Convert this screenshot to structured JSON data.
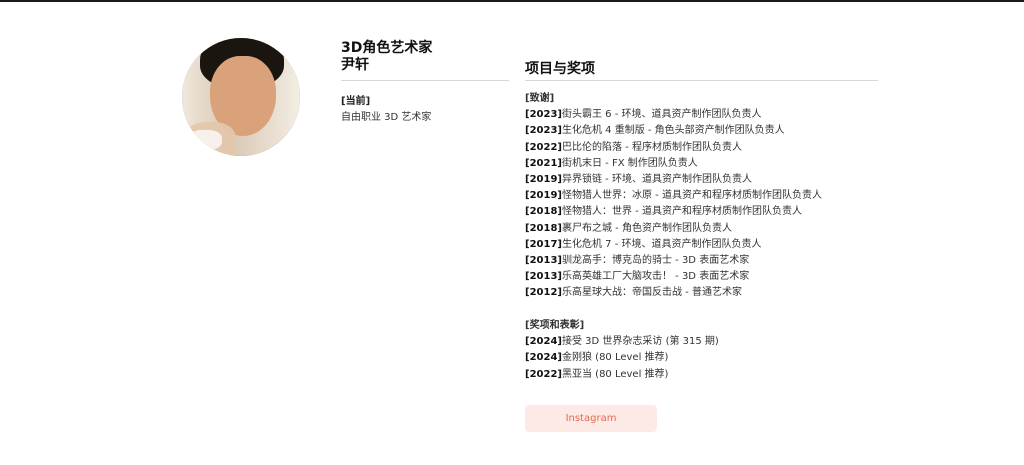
{
  "profile": {
    "title_line1": "3D角色艺术家",
    "title_line2": "尹轩",
    "current_label": "[当前]",
    "current_value": "自由职业 3D 艺术家"
  },
  "projects": {
    "heading": "项目与奖项",
    "credits_label": "[致谢]",
    "credits": [
      {
        "year": "[2023]",
        "text": "街头霸王 6 - 环境、道具资产制作团队负责人"
      },
      {
        "year": "[2023]",
        "text": "生化危机 4 重制版 - 角色头部资产制作团队负责人"
      },
      {
        "year": "[2022]",
        "text": "巴比伦的陷落 - 程序材质制作团队负责人"
      },
      {
        "year": "[2021]",
        "text": "街机末日 - FX 制作团队负责人"
      },
      {
        "year": "[2019]",
        "text": "异界锁链 - 环境、道具资产制作团队负责人"
      },
      {
        "year": "[2019]",
        "text": "怪物猎人世界：冰原 - 道具资产和程序材质制作团队负责人"
      },
      {
        "year": "[2018]",
        "text": "怪物猎人：世界 - 道具资产和程序材质制作团队负责人"
      },
      {
        "year": "[2018]",
        "text": "裹尸布之城 - 角色资产制作团队负责人"
      },
      {
        "year": "[2017]",
        "text": "生化危机 7 - 环境、道具资产制作团队负责人"
      },
      {
        "year": "[2013]",
        "text": "驯龙高手：博克岛的骑士 - 3D 表面艺术家"
      },
      {
        "year": "[2013]",
        "text": "乐高英雄工厂大脑攻击！ - 3D 表面艺术家"
      },
      {
        "year": "[2012]",
        "text": "乐高星球大战：帝国反击战 - 普通艺术家"
      }
    ],
    "awards_label": "[奖项和表彰]",
    "awards": [
      {
        "year": "[2024]",
        "text": "接受 3D 世界杂志采访 (第 315 期)"
      },
      {
        "year": "[2024]",
        "text": "金刚狼 (80 Level 推荐)"
      },
      {
        "year": "[2022]",
        "text": "黑亚当 (80 Level 推荐)"
      }
    ]
  },
  "instagram_label": "Instagram",
  "colors": {
    "accent_text": "#e8684f",
    "accent_bg": "#fdeae6",
    "divider": "#d8d8d8"
  }
}
